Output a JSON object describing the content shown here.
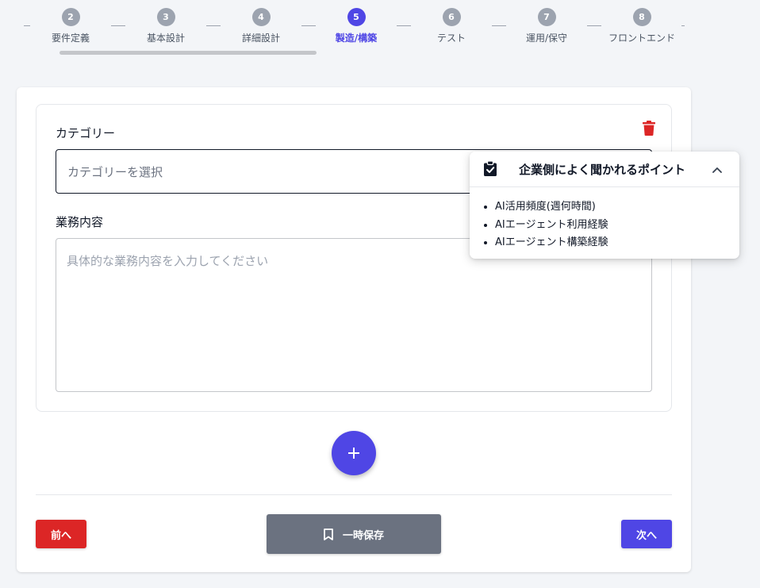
{
  "stepper": {
    "steps": [
      {
        "number": "2",
        "label": "要件定義",
        "active": false
      },
      {
        "number": "3",
        "label": "基本設計",
        "active": false
      },
      {
        "number": "4",
        "label": "詳細設計",
        "active": false
      },
      {
        "number": "5",
        "label": "製造/構築",
        "active": true
      },
      {
        "number": "6",
        "label": "テスト",
        "active": false
      },
      {
        "number": "7",
        "label": "運用/保守",
        "active": false
      },
      {
        "number": "8",
        "label": "フロントエンド",
        "active": false
      }
    ],
    "active_color": "#4f46e5",
    "inactive_color": "#9ca3af"
  },
  "form": {
    "category_label": "カテゴリー",
    "category_placeholder": "カテゴリーを選択",
    "business_label": "業務内容",
    "business_placeholder": "具体的な業務内容を入力してください",
    "delete_icon": "trash-icon",
    "add_icon": "plus-icon"
  },
  "tips": {
    "title": "企業側によく聞かれるポイント",
    "icon": "clipboard-check-icon",
    "collapse_icon": "chevron-up-icon",
    "items": [
      "AI活用頻度(週何時間)",
      "AIエージェント利用経験",
      "AIエージェント構築経験"
    ]
  },
  "footer": {
    "prev_label": "前へ",
    "save_label": "一時保存",
    "save_icon": "bookmark-icon",
    "next_label": "次へ"
  },
  "colors": {
    "primary": "#4f46e5",
    "danger": "#dc2626",
    "neutral_button": "#6b7280"
  }
}
